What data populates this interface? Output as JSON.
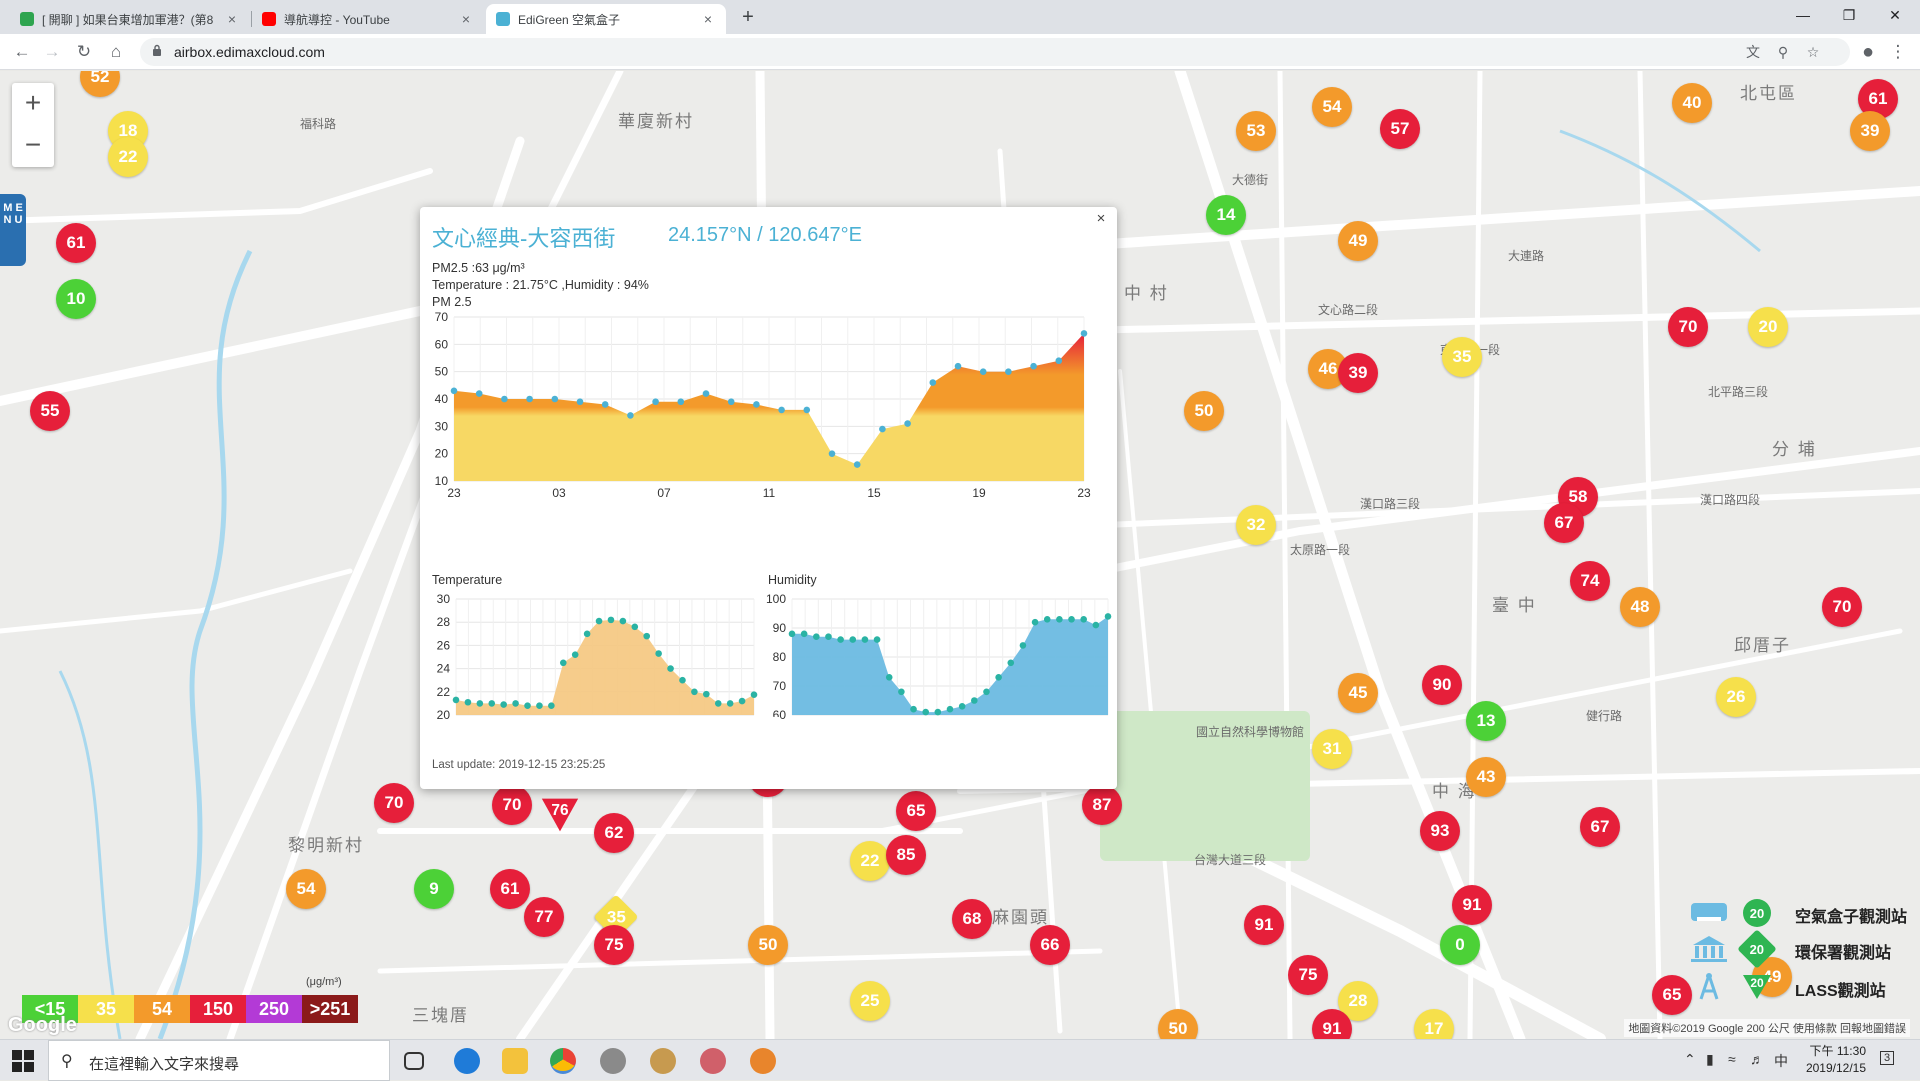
{
  "browser": {
    "tabs": [
      {
        "title": "[ 開聊 ] 如果台東增加軍港？(第8",
        "color": "#2ea44f",
        "active": false
      },
      {
        "title": "導航導控 - YouTube",
        "color": "#ff0000",
        "active": false
      },
      {
        "title": "EdiGreen 空氣盒子",
        "color": "#4bb1d4",
        "active": true
      }
    ],
    "url": "airbox.edimaxcloud.com",
    "new_tab": "+",
    "tab_close": "×"
  },
  "map": {
    "zoom_in": "+",
    "zoom_out": "−",
    "menu_label": "M E N U",
    "labels": [
      {
        "text": "華廈新村",
        "big": true
      },
      {
        "text": "黎明新村",
        "big": true
      },
      {
        "text": "麻園頭",
        "big": true
      },
      {
        "text": "三塊厝",
        "big": true
      },
      {
        "text": "臺 中",
        "big": true
      },
      {
        "text": "邱厝子",
        "big": true
      },
      {
        "text": "中 海",
        "big": true
      },
      {
        "text": "北屯區",
        "big": true
      },
      {
        "text": "分 埔",
        "big": true
      },
      {
        "text": "中 村",
        "big": true
      },
      {
        "text": "文心路二段",
        "big": false
      },
      {
        "text": "大德街",
        "big": false
      },
      {
        "text": "台灣大道三段",
        "big": false
      },
      {
        "text": "太原路一段",
        "big": false
      },
      {
        "text": "北平路三段",
        "big": false
      },
      {
        "text": "漢口路四段",
        "big": false
      },
      {
        "text": "健行路",
        "big": false
      },
      {
        "text": "國立自然科學博物館",
        "big": false
      },
      {
        "text": "東興路一段",
        "big": false
      },
      {
        "text": "福科路",
        "big": false
      },
      {
        "text": "大連路",
        "big": false
      },
      {
        "text": "漢口路三段",
        "big": false
      }
    ],
    "markers": [
      {
        "v": "52",
        "c": "o"
      },
      {
        "v": "18",
        "c": "y"
      },
      {
        "v": "22",
        "c": "y"
      },
      {
        "v": "61",
        "c": "r"
      },
      {
        "v": "10",
        "c": "g"
      },
      {
        "v": "55",
        "c": "r"
      },
      {
        "v": "53",
        "c": "o"
      },
      {
        "v": "54",
        "c": "o"
      },
      {
        "v": "57",
        "c": "r"
      },
      {
        "v": "40",
        "c": "o"
      },
      {
        "v": "61",
        "c": "r"
      },
      {
        "v": "39",
        "c": "o"
      },
      {
        "v": "14",
        "c": "g"
      },
      {
        "v": "49",
        "c": "o"
      },
      {
        "v": "70",
        "c": "r"
      },
      {
        "v": "20",
        "c": "y"
      },
      {
        "v": "46",
        "c": "o"
      },
      {
        "v": "39",
        "c": "r"
      },
      {
        "v": "35",
        "c": "y"
      },
      {
        "v": "50",
        "c": "o"
      },
      {
        "v": "58",
        "c": "r"
      },
      {
        "v": "67",
        "c": "r"
      },
      {
        "v": "32",
        "c": "y"
      },
      {
        "v": "74",
        "c": "r"
      },
      {
        "v": "48",
        "c": "o"
      },
      {
        "v": "70",
        "c": "r"
      },
      {
        "v": "45",
        "c": "o"
      },
      {
        "v": "90",
        "c": "r"
      },
      {
        "v": "13",
        "c": "g"
      },
      {
        "v": "26",
        "c": "y"
      },
      {
        "v": "31",
        "c": "y"
      },
      {
        "v": "43",
        "c": "o"
      },
      {
        "v": "54",
        "c": "o"
      },
      {
        "v": "63",
        "c": "r"
      },
      {
        "v": "70",
        "c": "r"
      },
      {
        "v": "70",
        "c": "r"
      },
      {
        "v": "76",
        "c": "r"
      },
      {
        "v": "62",
        "c": "r"
      },
      {
        "v": "65",
        "c": "r"
      },
      {
        "v": "87",
        "c": "r"
      },
      {
        "v": "93",
        "c": "r"
      },
      {
        "v": "67",
        "c": "r"
      },
      {
        "v": "54",
        "c": "o"
      },
      {
        "v": "9",
        "c": "g"
      },
      {
        "v": "61",
        "c": "r"
      },
      {
        "v": "77",
        "c": "r"
      },
      {
        "v": "35",
        "c": "y"
      },
      {
        "v": "75",
        "c": "r"
      },
      {
        "v": "22",
        "c": "y"
      },
      {
        "v": "85",
        "c": "r"
      },
      {
        "v": "68",
        "c": "r"
      },
      {
        "v": "66",
        "c": "r"
      },
      {
        "v": "91",
        "c": "r"
      },
      {
        "v": "91",
        "c": "r"
      },
      {
        "v": "0",
        "c": "g"
      },
      {
        "v": "50",
        "c": "o"
      },
      {
        "v": "75",
        "c": "r"
      },
      {
        "v": "28",
        "c": "y"
      },
      {
        "v": "91",
        "c": "r"
      },
      {
        "v": "50",
        "c": "o"
      },
      {
        "v": "17",
        "c": "y"
      },
      {
        "v": "25",
        "c": "y"
      },
      {
        "v": "65",
        "c": "r"
      },
      {
        "v": "49",
        "c": "o"
      }
    ],
    "legend": [
      {
        "label": "<15",
        "color": "#4cd137"
      },
      {
        "label": "35",
        "color": "#f6e04b"
      },
      {
        "label": "54",
        "color": "#f39a2b"
      },
      {
        "label": "150",
        "color": "#e61f3a"
      },
      {
        "label": "250",
        "color": "#b33ad6"
      },
      {
        "label": ">251",
        "color": "#8b1a1a"
      }
    ],
    "legend_unit": "(μg/m³)",
    "google_logo": "Google",
    "attribution": "地圖資料©2019 Google   200 公尺   使用條款   回報地圖錯誤",
    "station_legend": [
      {
        "label": "空氣盒子觀測站",
        "badge": "20"
      },
      {
        "label": "環保署觀測站",
        "badge": "20"
      },
      {
        "label": "LASS觀測站",
        "badge": "20"
      }
    ]
  },
  "popup": {
    "title": "文心經典-大容西街",
    "coords": "24.157°N / 120.647°E",
    "pm25": "PM2.5 :63 μg/m³",
    "temp_humidity": "Temperature : 21.75°C ,Humidity : 94%",
    "chart_title": "PM 2.5",
    "temp_title": "Temperature",
    "hum_title": "Humidity",
    "last_update": "Last update: 2019-12-15 23:25:25",
    "close": "×"
  },
  "chart_data": [
    {
      "type": "area",
      "title": "PM 2.5",
      "ylim": [
        10,
        70
      ],
      "yticks": [
        10,
        20,
        30,
        40,
        50,
        60,
        70
      ],
      "xticks": [
        "23",
        "03",
        "07",
        "11",
        "15",
        "19",
        "23"
      ],
      "x_hours": [
        0,
        1,
        2,
        3,
        4,
        5,
        6,
        7,
        8,
        9,
        10,
        11,
        12,
        13,
        14,
        15,
        16,
        17,
        18,
        19,
        20,
        21,
        22,
        23,
        24
      ],
      "values": [
        43,
        42,
        40,
        40,
        40,
        39,
        38,
        34,
        39,
        39,
        42,
        39,
        38,
        36,
        36,
        20,
        16,
        29,
        31,
        46,
        52,
        50,
        50,
        52,
        54,
        64
      ],
      "colors": {
        "fill_low": "#f7d864",
        "fill_mid": "#f39a2b",
        "fill_high": "#e61f3a",
        "dot": "#4bb1d4"
      }
    },
    {
      "type": "area",
      "title": "Temperature",
      "ylim": [
        20,
        30
      ],
      "yticks": [
        20,
        22,
        24,
        26,
        28,
        30
      ],
      "values": [
        21.3,
        21.1,
        21.0,
        21.0,
        20.9,
        21.0,
        20.8,
        20.8,
        20.8,
        24.5,
        25.2,
        27.0,
        28.1,
        28.2,
        28.1,
        27.6,
        26.8,
        25.3,
        24.0,
        23.0,
        22.0,
        21.8,
        21.0,
        21.0,
        21.2,
        21.75
      ],
      "colors": {
        "fill": "#f5c77e",
        "dot": "#2ab3a4"
      }
    },
    {
      "type": "area",
      "title": "Humidity",
      "ylim": [
        60,
        100
      ],
      "yticks": [
        60,
        70,
        80,
        90,
        100
      ],
      "values": [
        88,
        88,
        87,
        87,
        86,
        86,
        86,
        86,
        73,
        68,
        62,
        61,
        61,
        62,
        63,
        65,
        68,
        73,
        78,
        84,
        92,
        93,
        93,
        93,
        93,
        91,
        94
      ],
      "colors": {
        "fill": "#6cbbe2",
        "dot": "#2ab3a4"
      }
    }
  ],
  "taskbar": {
    "search_placeholder": "在這裡輸入文字來搜尋",
    "time": "下午 11:30",
    "date": "2019/12/15",
    "ime": "中",
    "notifications": "3"
  }
}
